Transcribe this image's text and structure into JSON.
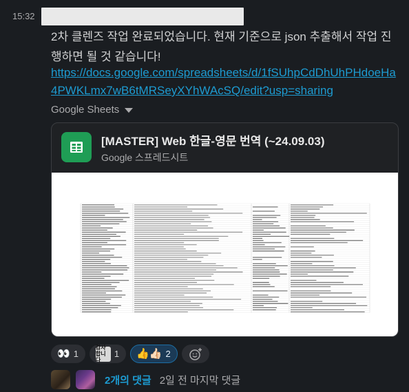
{
  "message": {
    "time": "15:32",
    "text": "2차 클렌즈 작업 완료되었습니다. 현재 기준으로 json 추출해서 작업 진행하면 될 것 같습니다!",
    "link": "https://docs.google.com/spreadsheets/d/1fSUhpCdDhUhPHdoeHa4PWKLmx7wB6tMRSeyXYhWAcSQ/edit?usp=sharing",
    "source": "Google Sheets"
  },
  "card": {
    "title": "[MASTER] Web 한글-영문 번역 (~24.09.03)",
    "subtitle": "Google 스프레드시트",
    "icon": "google-sheets-icon",
    "icon_color": "#1f9d55"
  },
  "reactions": [
    {
      "emoji": "👀",
      "count": "1",
      "icon": "eyes-emoji"
    },
    {
      "emoji_text": "감사 합니다",
      "count": "1",
      "icon": "thanks-custom-emoji"
    },
    {
      "emoji": "👍👍🏻",
      "count": "2",
      "icon": "thumbs-up-emoji",
      "active": true
    }
  ],
  "thread": {
    "reply_count": "2개의 댓글",
    "last_reply": "2일 전 마지막 댓글"
  },
  "colors": {
    "background": "#1a1d21",
    "link": "#1d9bd1",
    "active_reaction": "#1b3a56"
  }
}
